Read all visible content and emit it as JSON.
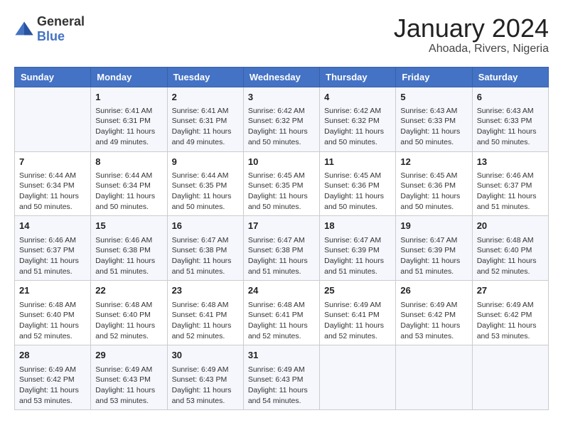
{
  "header": {
    "logo_general": "General",
    "logo_blue": "Blue",
    "month": "January 2024",
    "location": "Ahoada, Rivers, Nigeria"
  },
  "columns": [
    "Sunday",
    "Monday",
    "Tuesday",
    "Wednesday",
    "Thursday",
    "Friday",
    "Saturday"
  ],
  "weeks": [
    [
      {
        "day": "",
        "info": ""
      },
      {
        "day": "1",
        "info": "Sunrise: 6:41 AM\nSunset: 6:31 PM\nDaylight: 11 hours\nand 49 minutes."
      },
      {
        "day": "2",
        "info": "Sunrise: 6:41 AM\nSunset: 6:31 PM\nDaylight: 11 hours\nand 49 minutes."
      },
      {
        "day": "3",
        "info": "Sunrise: 6:42 AM\nSunset: 6:32 PM\nDaylight: 11 hours\nand 50 minutes."
      },
      {
        "day": "4",
        "info": "Sunrise: 6:42 AM\nSunset: 6:32 PM\nDaylight: 11 hours\nand 50 minutes."
      },
      {
        "day": "5",
        "info": "Sunrise: 6:43 AM\nSunset: 6:33 PM\nDaylight: 11 hours\nand 50 minutes."
      },
      {
        "day": "6",
        "info": "Sunrise: 6:43 AM\nSunset: 6:33 PM\nDaylight: 11 hours\nand 50 minutes."
      }
    ],
    [
      {
        "day": "7",
        "info": "Sunrise: 6:44 AM\nSunset: 6:34 PM\nDaylight: 11 hours\nand 50 minutes."
      },
      {
        "day": "8",
        "info": "Sunrise: 6:44 AM\nSunset: 6:34 PM\nDaylight: 11 hours\nand 50 minutes."
      },
      {
        "day": "9",
        "info": "Sunrise: 6:44 AM\nSunset: 6:35 PM\nDaylight: 11 hours\nand 50 minutes."
      },
      {
        "day": "10",
        "info": "Sunrise: 6:45 AM\nSunset: 6:35 PM\nDaylight: 11 hours\nand 50 minutes."
      },
      {
        "day": "11",
        "info": "Sunrise: 6:45 AM\nSunset: 6:36 PM\nDaylight: 11 hours\nand 50 minutes."
      },
      {
        "day": "12",
        "info": "Sunrise: 6:45 AM\nSunset: 6:36 PM\nDaylight: 11 hours\nand 50 minutes."
      },
      {
        "day": "13",
        "info": "Sunrise: 6:46 AM\nSunset: 6:37 PM\nDaylight: 11 hours\nand 51 minutes."
      }
    ],
    [
      {
        "day": "14",
        "info": "Sunrise: 6:46 AM\nSunset: 6:37 PM\nDaylight: 11 hours\nand 51 minutes."
      },
      {
        "day": "15",
        "info": "Sunrise: 6:46 AM\nSunset: 6:38 PM\nDaylight: 11 hours\nand 51 minutes."
      },
      {
        "day": "16",
        "info": "Sunrise: 6:47 AM\nSunset: 6:38 PM\nDaylight: 11 hours\nand 51 minutes."
      },
      {
        "day": "17",
        "info": "Sunrise: 6:47 AM\nSunset: 6:38 PM\nDaylight: 11 hours\nand 51 minutes."
      },
      {
        "day": "18",
        "info": "Sunrise: 6:47 AM\nSunset: 6:39 PM\nDaylight: 11 hours\nand 51 minutes."
      },
      {
        "day": "19",
        "info": "Sunrise: 6:47 AM\nSunset: 6:39 PM\nDaylight: 11 hours\nand 51 minutes."
      },
      {
        "day": "20",
        "info": "Sunrise: 6:48 AM\nSunset: 6:40 PM\nDaylight: 11 hours\nand 52 minutes."
      }
    ],
    [
      {
        "day": "21",
        "info": "Sunrise: 6:48 AM\nSunset: 6:40 PM\nDaylight: 11 hours\nand 52 minutes."
      },
      {
        "day": "22",
        "info": "Sunrise: 6:48 AM\nSunset: 6:40 PM\nDaylight: 11 hours\nand 52 minutes."
      },
      {
        "day": "23",
        "info": "Sunrise: 6:48 AM\nSunset: 6:41 PM\nDaylight: 11 hours\nand 52 minutes."
      },
      {
        "day": "24",
        "info": "Sunrise: 6:48 AM\nSunset: 6:41 PM\nDaylight: 11 hours\nand 52 minutes."
      },
      {
        "day": "25",
        "info": "Sunrise: 6:49 AM\nSunset: 6:41 PM\nDaylight: 11 hours\nand 52 minutes."
      },
      {
        "day": "26",
        "info": "Sunrise: 6:49 AM\nSunset: 6:42 PM\nDaylight: 11 hours\nand 53 minutes."
      },
      {
        "day": "27",
        "info": "Sunrise: 6:49 AM\nSunset: 6:42 PM\nDaylight: 11 hours\nand 53 minutes."
      }
    ],
    [
      {
        "day": "28",
        "info": "Sunrise: 6:49 AM\nSunset: 6:42 PM\nDaylight: 11 hours\nand 53 minutes."
      },
      {
        "day": "29",
        "info": "Sunrise: 6:49 AM\nSunset: 6:43 PM\nDaylight: 11 hours\nand 53 minutes."
      },
      {
        "day": "30",
        "info": "Sunrise: 6:49 AM\nSunset: 6:43 PM\nDaylight: 11 hours\nand 53 minutes."
      },
      {
        "day": "31",
        "info": "Sunrise: 6:49 AM\nSunset: 6:43 PM\nDaylight: 11 hours\nand 54 minutes."
      },
      {
        "day": "",
        "info": ""
      },
      {
        "day": "",
        "info": ""
      },
      {
        "day": "",
        "info": ""
      }
    ]
  ]
}
